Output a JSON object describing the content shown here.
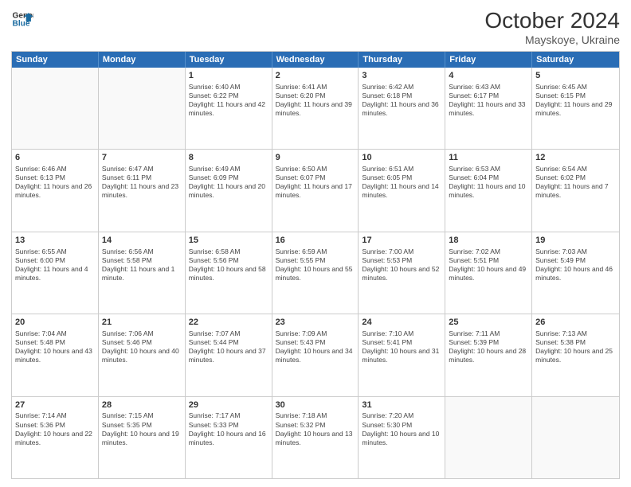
{
  "header": {
    "logo_line1": "General",
    "logo_line2": "Blue",
    "month": "October 2024",
    "location": "Mayskoye, Ukraine"
  },
  "days_of_week": [
    "Sunday",
    "Monday",
    "Tuesday",
    "Wednesday",
    "Thursday",
    "Friday",
    "Saturday"
  ],
  "rows": [
    [
      {
        "day": "",
        "text": ""
      },
      {
        "day": "",
        "text": ""
      },
      {
        "day": "1",
        "text": "Sunrise: 6:40 AM\nSunset: 6:22 PM\nDaylight: 11 hours and 42 minutes."
      },
      {
        "day": "2",
        "text": "Sunrise: 6:41 AM\nSunset: 6:20 PM\nDaylight: 11 hours and 39 minutes."
      },
      {
        "day": "3",
        "text": "Sunrise: 6:42 AM\nSunset: 6:18 PM\nDaylight: 11 hours and 36 minutes."
      },
      {
        "day": "4",
        "text": "Sunrise: 6:43 AM\nSunset: 6:17 PM\nDaylight: 11 hours and 33 minutes."
      },
      {
        "day": "5",
        "text": "Sunrise: 6:45 AM\nSunset: 6:15 PM\nDaylight: 11 hours and 29 minutes."
      }
    ],
    [
      {
        "day": "6",
        "text": "Sunrise: 6:46 AM\nSunset: 6:13 PM\nDaylight: 11 hours and 26 minutes."
      },
      {
        "day": "7",
        "text": "Sunrise: 6:47 AM\nSunset: 6:11 PM\nDaylight: 11 hours and 23 minutes."
      },
      {
        "day": "8",
        "text": "Sunrise: 6:49 AM\nSunset: 6:09 PM\nDaylight: 11 hours and 20 minutes."
      },
      {
        "day": "9",
        "text": "Sunrise: 6:50 AM\nSunset: 6:07 PM\nDaylight: 11 hours and 17 minutes."
      },
      {
        "day": "10",
        "text": "Sunrise: 6:51 AM\nSunset: 6:05 PM\nDaylight: 11 hours and 14 minutes."
      },
      {
        "day": "11",
        "text": "Sunrise: 6:53 AM\nSunset: 6:04 PM\nDaylight: 11 hours and 10 minutes."
      },
      {
        "day": "12",
        "text": "Sunrise: 6:54 AM\nSunset: 6:02 PM\nDaylight: 11 hours and 7 minutes."
      }
    ],
    [
      {
        "day": "13",
        "text": "Sunrise: 6:55 AM\nSunset: 6:00 PM\nDaylight: 11 hours and 4 minutes."
      },
      {
        "day": "14",
        "text": "Sunrise: 6:56 AM\nSunset: 5:58 PM\nDaylight: 11 hours and 1 minute."
      },
      {
        "day": "15",
        "text": "Sunrise: 6:58 AM\nSunset: 5:56 PM\nDaylight: 10 hours and 58 minutes."
      },
      {
        "day": "16",
        "text": "Sunrise: 6:59 AM\nSunset: 5:55 PM\nDaylight: 10 hours and 55 minutes."
      },
      {
        "day": "17",
        "text": "Sunrise: 7:00 AM\nSunset: 5:53 PM\nDaylight: 10 hours and 52 minutes."
      },
      {
        "day": "18",
        "text": "Sunrise: 7:02 AM\nSunset: 5:51 PM\nDaylight: 10 hours and 49 minutes."
      },
      {
        "day": "19",
        "text": "Sunrise: 7:03 AM\nSunset: 5:49 PM\nDaylight: 10 hours and 46 minutes."
      }
    ],
    [
      {
        "day": "20",
        "text": "Sunrise: 7:04 AM\nSunset: 5:48 PM\nDaylight: 10 hours and 43 minutes."
      },
      {
        "day": "21",
        "text": "Sunrise: 7:06 AM\nSunset: 5:46 PM\nDaylight: 10 hours and 40 minutes."
      },
      {
        "day": "22",
        "text": "Sunrise: 7:07 AM\nSunset: 5:44 PM\nDaylight: 10 hours and 37 minutes."
      },
      {
        "day": "23",
        "text": "Sunrise: 7:09 AM\nSunset: 5:43 PM\nDaylight: 10 hours and 34 minutes."
      },
      {
        "day": "24",
        "text": "Sunrise: 7:10 AM\nSunset: 5:41 PM\nDaylight: 10 hours and 31 minutes."
      },
      {
        "day": "25",
        "text": "Sunrise: 7:11 AM\nSunset: 5:39 PM\nDaylight: 10 hours and 28 minutes."
      },
      {
        "day": "26",
        "text": "Sunrise: 7:13 AM\nSunset: 5:38 PM\nDaylight: 10 hours and 25 minutes."
      }
    ],
    [
      {
        "day": "27",
        "text": "Sunrise: 7:14 AM\nSunset: 5:36 PM\nDaylight: 10 hours and 22 minutes."
      },
      {
        "day": "28",
        "text": "Sunrise: 7:15 AM\nSunset: 5:35 PM\nDaylight: 10 hours and 19 minutes."
      },
      {
        "day": "29",
        "text": "Sunrise: 7:17 AM\nSunset: 5:33 PM\nDaylight: 10 hours and 16 minutes."
      },
      {
        "day": "30",
        "text": "Sunrise: 7:18 AM\nSunset: 5:32 PM\nDaylight: 10 hours and 13 minutes."
      },
      {
        "day": "31",
        "text": "Sunrise: 7:20 AM\nSunset: 5:30 PM\nDaylight: 10 hours and 10 minutes."
      },
      {
        "day": "",
        "text": ""
      },
      {
        "day": "",
        "text": ""
      }
    ]
  ]
}
